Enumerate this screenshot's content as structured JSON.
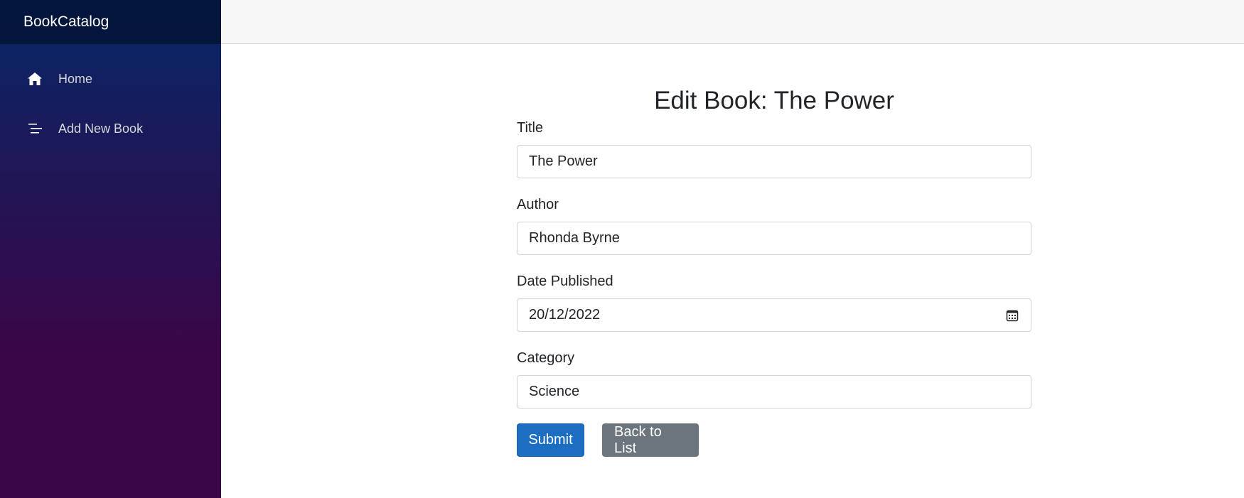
{
  "brand": "BookCatalog",
  "nav": [
    {
      "label": "Home",
      "icon": "home-icon"
    },
    {
      "label": "Add New Book",
      "icon": "list-icon"
    }
  ],
  "page": {
    "title": "Edit Book: The Power"
  },
  "form": {
    "title": {
      "label": "Title",
      "value": "The Power"
    },
    "author": {
      "label": "Author",
      "value": "Rhonda Byrne"
    },
    "date_published": {
      "label": "Date Published",
      "value": "20/12/2022"
    },
    "category": {
      "label": "Category",
      "value": "Science"
    }
  },
  "buttons": {
    "submit": "Submit",
    "back": "Back to List"
  },
  "colors": {
    "sidebar_top": "#052767",
    "sidebar_bottom": "#3a0647",
    "primary": "#1b6ec2",
    "secondary": "#6c757d"
  }
}
